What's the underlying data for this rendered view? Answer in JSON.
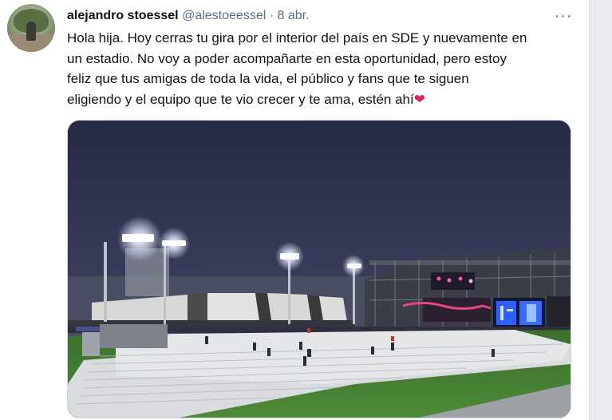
{
  "tweet": {
    "author_name": "alejandro stoessel",
    "handle": "@alestoeessel",
    "separator": "·",
    "date": "8 abr.",
    "more_icon": "more-horizontal-icon",
    "text_lines": [
      "Hola hija. Hoy cerras tu gira por el interior del país en SDE y nuevamente en",
      "un estadio. No voy a poder acompañarte en esta oportunidad, pero estoy",
      "feliz que tus amigas de toda la vida, el público y fans que te siguen",
      "eligiendo y el equipo que te vio crecer y te ama, estén ahí"
    ],
    "emoji": "❤",
    "heart_color": "#e0245e"
  },
  "colors": {
    "name": "#0f1419",
    "meta": "#5b7083",
    "sky_top": "#2a2d48",
    "sky_bottom": "#5b6178",
    "grass": "#3f7a2f"
  }
}
